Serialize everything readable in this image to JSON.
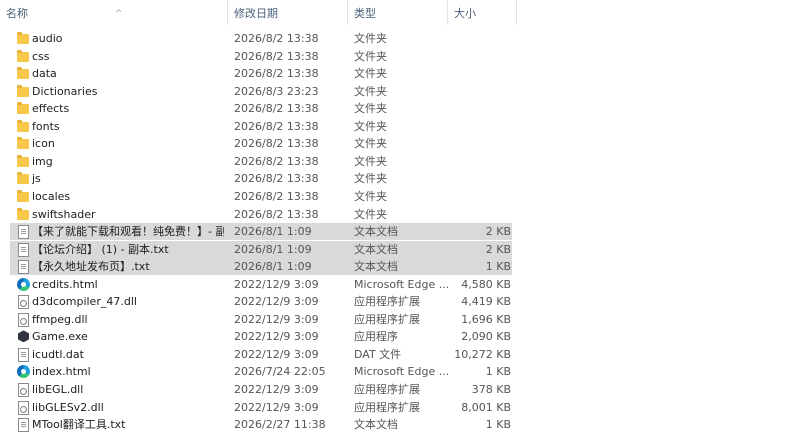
{
  "columns": {
    "name": "名称",
    "date": "修改日期",
    "type": "类型",
    "size": "大小",
    "sort_indicator": "^"
  },
  "files": [
    {
      "name": "audio",
      "date": "2026/8/2 13:38",
      "type": "文件夹",
      "size": "",
      "icon": "folder-icon",
      "selected": false
    },
    {
      "name": "css",
      "date": "2026/8/2 13:38",
      "type": "文件夹",
      "size": "",
      "icon": "folder-icon",
      "selected": false
    },
    {
      "name": "data",
      "date": "2026/8/2 13:38",
      "type": "文件夹",
      "size": "",
      "icon": "folder-icon",
      "selected": false
    },
    {
      "name": "Dictionaries",
      "date": "2026/8/3 23:23",
      "type": "文件夹",
      "size": "",
      "icon": "folder-icon",
      "selected": false
    },
    {
      "name": "effects",
      "date": "2026/8/2 13:38",
      "type": "文件夹",
      "size": "",
      "icon": "folder-icon",
      "selected": false
    },
    {
      "name": "fonts",
      "date": "2026/8/2 13:38",
      "type": "文件夹",
      "size": "",
      "icon": "folder-icon",
      "selected": false
    },
    {
      "name": "icon",
      "date": "2026/8/2 13:38",
      "type": "文件夹",
      "size": "",
      "icon": "folder-icon",
      "selected": false
    },
    {
      "name": "img",
      "date": "2026/8/2 13:38",
      "type": "文件夹",
      "size": "",
      "icon": "folder-icon",
      "selected": false
    },
    {
      "name": "js",
      "date": "2026/8/2 13:38",
      "type": "文件夹",
      "size": "",
      "icon": "folder-icon",
      "selected": false
    },
    {
      "name": "locales",
      "date": "2026/8/2 13:38",
      "type": "文件夹",
      "size": "",
      "icon": "folder-icon",
      "selected": false
    },
    {
      "name": "swiftshader",
      "date": "2026/8/2 13:38",
      "type": "文件夹",
      "size": "",
      "icon": "folder-icon",
      "selected": false
    },
    {
      "name": "【来了就能下载和观看！纯免费！】- 副...",
      "date": "2026/8/1 1:09",
      "type": "文本文档",
      "size": "2 KB",
      "icon": "text-document-icon",
      "selected": true
    },
    {
      "name": "【论坛介绍】 (1) - 副本.txt",
      "date": "2026/8/1 1:09",
      "type": "文本文档",
      "size": "2 KB",
      "icon": "text-document-icon",
      "selected": true
    },
    {
      "name": "【永久地址发布页】.txt",
      "date": "2026/8/1 1:09",
      "type": "文本文档",
      "size": "1 KB",
      "icon": "text-document-icon",
      "selected": true
    },
    {
      "name": "credits.html",
      "date": "2022/12/9 3:09",
      "type": "Microsoft Edge ...",
      "size": "4,580 KB",
      "icon": "edge-icon",
      "selected": false
    },
    {
      "name": "d3dcompiler_47.dll",
      "date": "2022/12/9 3:09",
      "type": "应用程序扩展",
      "size": "4,419 KB",
      "icon": "dll-icon",
      "selected": false
    },
    {
      "name": "ffmpeg.dll",
      "date": "2022/12/9 3:09",
      "type": "应用程序扩展",
      "size": "1,696 KB",
      "icon": "dll-icon",
      "selected": false
    },
    {
      "name": "Game.exe",
      "date": "2022/12/9 3:09",
      "type": "应用程序",
      "size": "2,090 KB",
      "icon": "game-exe-icon",
      "selected": false
    },
    {
      "name": "icudtl.dat",
      "date": "2022/12/9 3:09",
      "type": "DAT 文件",
      "size": "10,272 KB",
      "icon": "file-icon",
      "selected": false
    },
    {
      "name": "index.html",
      "date": "2026/7/24 22:05",
      "type": "Microsoft Edge ...",
      "size": "1 KB",
      "icon": "edge-icon",
      "selected": false
    },
    {
      "name": "libEGL.dll",
      "date": "2022/12/9 3:09",
      "type": "应用程序扩展",
      "size": "378 KB",
      "icon": "dll-icon",
      "selected": false
    },
    {
      "name": "libGLESv2.dll",
      "date": "2022/12/9 3:09",
      "type": "应用程序扩展",
      "size": "8,001 KB",
      "icon": "dll-icon",
      "selected": false
    },
    {
      "name": "MTool翻译工具.txt",
      "date": "2026/2/27 11:38",
      "type": "文本文档",
      "size": "1 KB",
      "icon": "text-document-icon",
      "selected": false
    }
  ]
}
